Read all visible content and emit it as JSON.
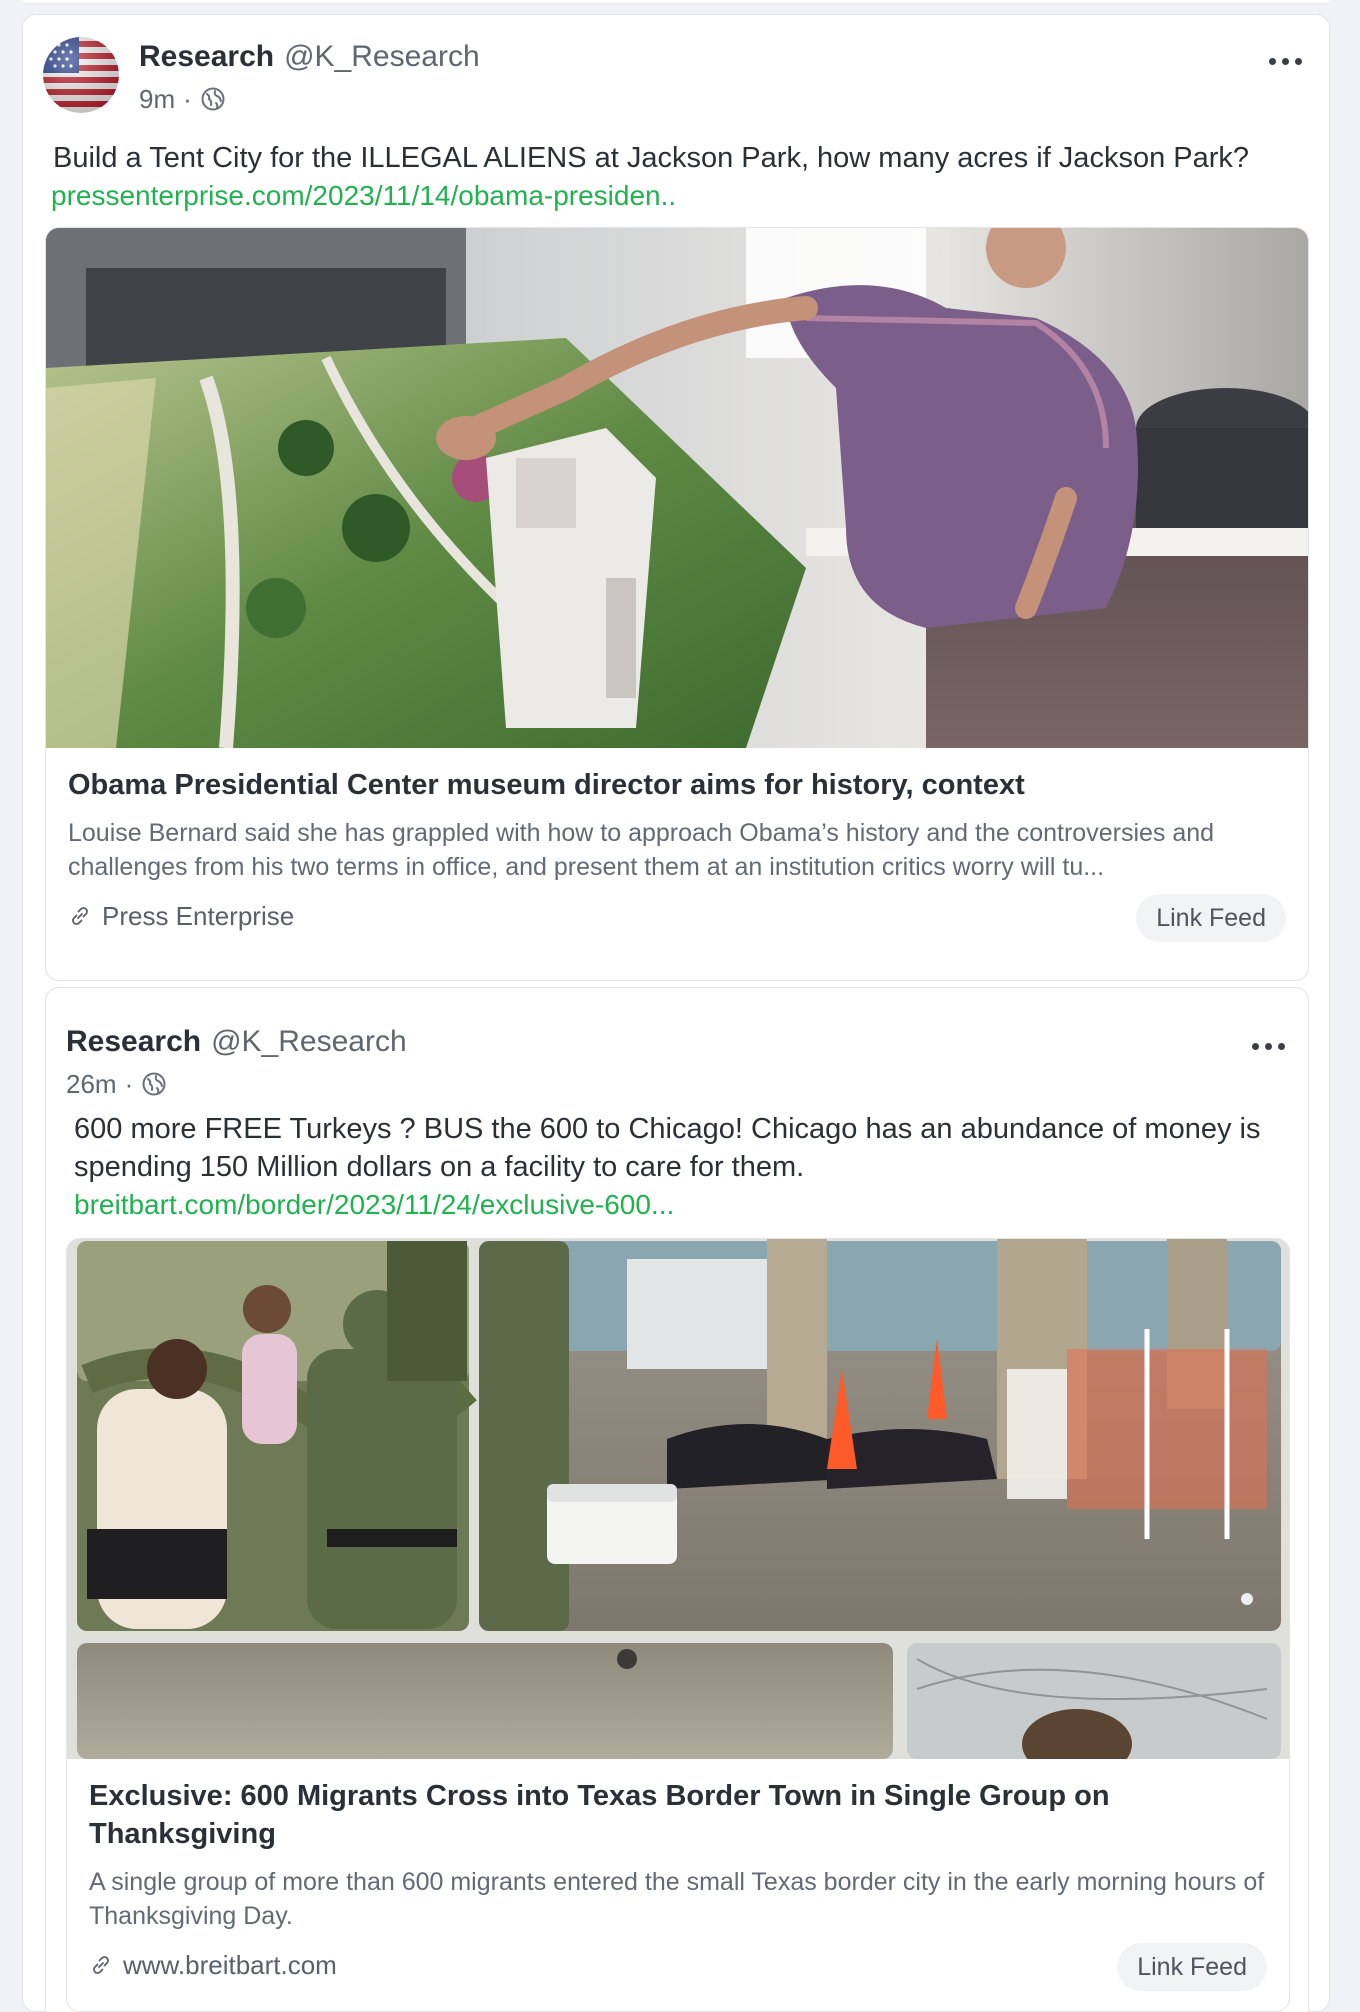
{
  "post": {
    "author_name": "Research",
    "author_handle": "@K_Research",
    "time": "9m",
    "meta_separator": "·",
    "text": "Build a Tent City for the ILLEGAL ALIENS at Jackson Park, how many acres if Jackson Park?",
    "link_text": "pressenterprise.com/2023/11/14/obama-presiden..",
    "preview": {
      "title": "Obama Presidential Center museum director aims for history, context",
      "description": "Louise Bernard said she has grappled with how to approach Obama’s history and the controversies and challenges from his two terms in office, and present them at an institution critics worry will tu...",
      "source": "Press Enterprise",
      "feed_label": "Link Feed"
    }
  },
  "nested_post": {
    "author_name": "Research",
    "author_handle": "@K_Research",
    "time": "26m",
    "meta_separator": "·",
    "text": "600 more FREE Turkeys ? BUS the 600 to Chicago! Chicago has an abundance of money is spending 150 Million dollars on a facility to care for them.",
    "link_text": "breitbart.com/border/2023/11/24/exclusive-600...",
    "preview": {
      "title": "Exclusive: 600 Migrants Cross into Texas Border Town in Single Group on Thanksgiving",
      "description": "A single group of more than 600 migrants entered the small Texas border city in the early morning hours of Thanksgiving Day.",
      "source": "www.breitbart.com",
      "feed_label": "Link Feed"
    }
  },
  "icons": {
    "avatar": "us-flag-avatar",
    "globe": "globe-icon",
    "more": "more-options-icon",
    "link": "link-icon"
  },
  "colors": {
    "link_green": "#20b24f",
    "background": "#f0f2f5",
    "card": "#ffffff"
  }
}
